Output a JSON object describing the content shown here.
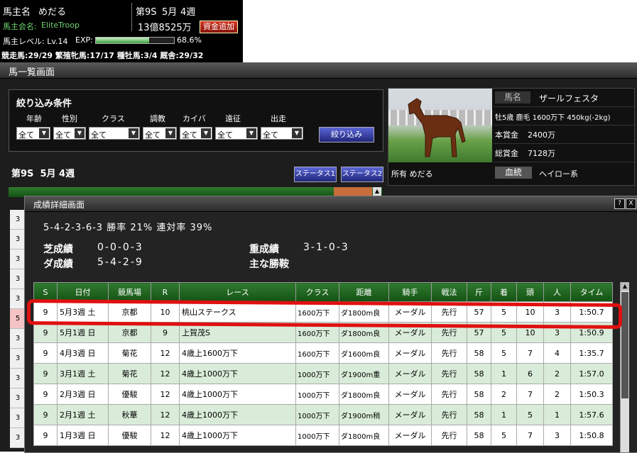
{
  "top": {
    "owner_label": "馬主名",
    "owner_name": "めだる",
    "club_label": "馬主会名:",
    "club_name": "EliteTroop",
    "season": "第9S",
    "month": "5月",
    "week": "4週",
    "money": "13億8525万",
    "add_funds": "資金追加",
    "level_text": "馬主レベル: Lv.14",
    "exp_label": "EXP:",
    "exp_percent": "68.6%",
    "exp_fraction": 0.686,
    "counts": [
      {
        "label": "競走馬:",
        "value": "29/29"
      },
      {
        "label": "繁殖牝馬:",
        "value": "17/17"
      },
      {
        "label": "種牡馬:",
        "value": "3/4"
      },
      {
        "label": "厩舎:",
        "value": "29/32"
      }
    ]
  },
  "main": {
    "title": "馬一覧画面",
    "filter_title": "絞り込み条件",
    "filters": [
      {
        "label": "年齢",
        "value": "全て"
      },
      {
        "label": "性別",
        "value": "全て"
      },
      {
        "label": "クラス",
        "value": "全て"
      },
      {
        "label": "調教",
        "value": "全て"
      },
      {
        "label": "カイバ",
        "value": "全て"
      },
      {
        "label": "遠征",
        "value": "全て"
      },
      {
        "label": "出走",
        "value": "全て"
      }
    ],
    "filter_button": "絞り込み",
    "week_label": "第9S  5月 4週",
    "status1": "ステータス1",
    "status2": "ステータス2",
    "left_rows": [
      "3",
      "3",
      "3",
      "3",
      "3",
      "3",
      "5",
      "3",
      "3",
      "3",
      "3",
      "3",
      "3"
    ]
  },
  "horse": {
    "name_label": "馬名",
    "name": "ザールフェスタ",
    "info": "牡5歳 鹿毛 1600万下 450kg(-2kg)",
    "prize_label": "本賞金",
    "prize": "2400万",
    "total_label": "総賞金",
    "total": "7128万",
    "owner_text": "所有 めだる",
    "pedigree_label": "血統",
    "pedigree": "ヘイロー系"
  },
  "dialog": {
    "title": "成績詳細画面",
    "help": "?",
    "close": "X",
    "record": "5-4-2-3-6-3  勝率 21%  連対率 39%",
    "turf_label": "芝成績",
    "turf": "0-0-0-3",
    "heavy_label": "重成績",
    "heavy": "3-1-0-3",
    "dirt_label": "ダ成績",
    "dirt": "5-4-2-9",
    "wins_label": "主な勝鞍",
    "headers": [
      "S",
      "日付",
      "競馬場",
      "R",
      "レース",
      "クラス",
      "距離",
      "騎手",
      "戦法",
      "斤",
      "着",
      "頭",
      "人",
      "タイム"
    ],
    "rows": [
      [
        "9",
        "5月3週 土",
        "京都",
        "10",
        "桃山ステークス",
        "1600万下",
        "ダ1800m良",
        "メーダル",
        "先行",
        "57",
        "5",
        "10",
        "3",
        "1:50.7"
      ],
      [
        "9",
        "5月1週 日",
        "京都",
        "9",
        "上賀茂S",
        "1600万下",
        "ダ1800m良",
        "メーダル",
        "先行",
        "57",
        "5",
        "10",
        "3",
        "1:50.9"
      ],
      [
        "9",
        "4月3週 日",
        "菊花",
        "12",
        "4歳上1600万下",
        "1600万下",
        "ダ1600m良",
        "メーダル",
        "先行",
        "58",
        "5",
        "7",
        "4",
        "1:35.7"
      ],
      [
        "9",
        "3月1週 土",
        "菊花",
        "12",
        "4歳上1000万下",
        "1000万下",
        "ダ1900m重",
        "メーダル",
        "先行",
        "58",
        "1",
        "6",
        "2",
        "1:57.0"
      ],
      [
        "9",
        "2月3週 日",
        "優駿",
        "12",
        "4歳上1000万下",
        "1000万下",
        "ダ1800m良",
        "メーダル",
        "先行",
        "58",
        "2",
        "7",
        "2",
        "1:50.3"
      ],
      [
        "9",
        "2月1週 土",
        "秋華",
        "12",
        "4歳上1000万下",
        "1000万下",
        "ダ1900m稍",
        "メーダル",
        "先行",
        "58",
        "1",
        "5",
        "1",
        "1:57.6"
      ],
      [
        "9",
        "1月3週 日",
        "優駿",
        "12",
        "4歳上1000万下",
        "1000万下",
        "ダ1800m良",
        "メーダル",
        "先行",
        "58",
        "5",
        "7",
        "3",
        "1:50.8"
      ]
    ]
  }
}
